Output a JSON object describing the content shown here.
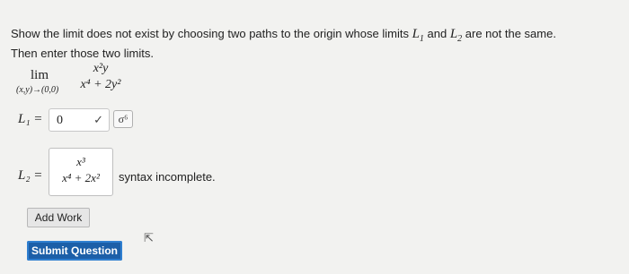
{
  "prompt": {
    "line1_before": "Show the limit does not exist by choosing two paths to the origin whose limits ",
    "L1": "L",
    "L1_sub": "1",
    "and": " and ",
    "L2": "L",
    "L2_sub": "2",
    "line1_after": " are not the same.",
    "line2": "Then enter those two limits."
  },
  "limit": {
    "word": "lim",
    "subscript": "(x,y)→(0,0)",
    "numerator": "x²y",
    "denominator": "x⁴ + 2y²"
  },
  "answer1": {
    "label": "L₁ =",
    "value": "0",
    "check": "✓",
    "link_icon": "σ⁶"
  },
  "answer2": {
    "label": "L₂ =",
    "numerator": "x³",
    "denominator": "x⁴ + 2x²",
    "message": "syntax incomplete."
  },
  "buttons": {
    "add_work": "Add Work",
    "submit": "Submit Question"
  }
}
